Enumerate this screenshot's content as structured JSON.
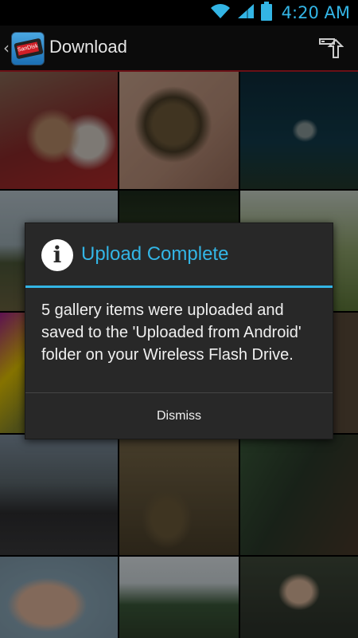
{
  "status_bar": {
    "time": "4:20 AM"
  },
  "action_bar": {
    "app_name": "SanDisk",
    "title": "Download"
  },
  "dialog": {
    "title": "Upload Complete",
    "message": "5 gallery items were uploaded and saved to the 'Uploaded from Android' folder on your Wireless Flash Drive.",
    "dismiss_label": "Dismiss"
  },
  "colors": {
    "accent": "#33b5e5",
    "dialog_bg": "#282828",
    "action_bar_underline": "#6b1016"
  },
  "icons": {
    "status": [
      "wifi-icon",
      "signal-icon",
      "battery-icon"
    ],
    "action_bar": [
      "up-caret-icon",
      "app-logo-icon",
      "upload-icon"
    ],
    "dialog": "info-icon"
  },
  "gallery": {
    "items": [
      {
        "subject": "dog-and-cat-photo"
      },
      {
        "subject": "tortoise-in-hand-photo"
      },
      {
        "subject": "shark-aquarium-photo"
      },
      {
        "subject": "outdoor-field-photo"
      },
      {
        "subject": "trees-photo"
      },
      {
        "subject": "grass-photo"
      },
      {
        "subject": "colorful-art-photo"
      },
      {
        "subject": "dark-photo"
      },
      {
        "subject": "playground-photo"
      },
      {
        "subject": "beach-people-photo"
      },
      {
        "subject": "tortoise-enclosure-photo"
      },
      {
        "subject": "playground-slide-photo"
      },
      {
        "subject": "child-face-photo"
      },
      {
        "subject": "fence-yard-photo"
      },
      {
        "subject": "girl-in-yard-photo"
      }
    ]
  }
}
